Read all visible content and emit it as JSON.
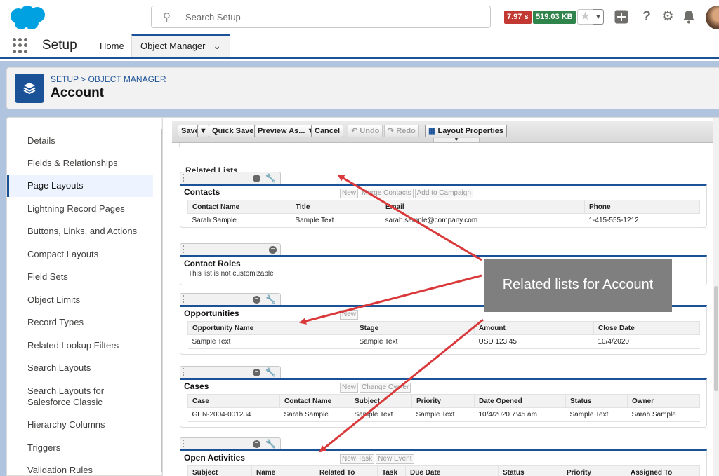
{
  "topbar": {
    "search_placeholder": "Search Setup",
    "badge_time": "7.97 s",
    "badge_size": "519.03 KB",
    "icons": [
      "salesforce-cloud-logo",
      "search-icon",
      "star-icon",
      "chevron-down-icon",
      "add-icon",
      "help-icon",
      "gear-icon",
      "bell-icon",
      "avatar"
    ]
  },
  "nav": {
    "app_name": "Setup",
    "tabs": [
      {
        "label": "Home",
        "active": false
      },
      {
        "label": "Object Manager",
        "active": true
      }
    ]
  },
  "header": {
    "breadcrumb": "SETUP > OBJECT MANAGER",
    "title": "Account"
  },
  "sidebar": {
    "items": [
      {
        "label": "Details",
        "active": false
      },
      {
        "label": "Fields & Relationships",
        "active": false
      },
      {
        "label": "Page Layouts",
        "active": true
      },
      {
        "label": "Lightning Record Pages",
        "active": false
      },
      {
        "label": "Buttons, Links, and Actions",
        "active": false
      },
      {
        "label": "Compact Layouts",
        "active": false
      },
      {
        "label": "Field Sets",
        "active": false
      },
      {
        "label": "Object Limits",
        "active": false
      },
      {
        "label": "Record Types",
        "active": false
      },
      {
        "label": "Related Lookup Filters",
        "active": false
      },
      {
        "label": "Search Layouts",
        "active": false
      },
      {
        "label": "Search Layouts for Salesforce Classic",
        "active": false
      },
      {
        "label": "Hierarchy Columns",
        "active": false
      },
      {
        "label": "Triggers",
        "active": false
      },
      {
        "label": "Validation Rules",
        "active": false
      }
    ]
  },
  "toolbar": {
    "save": "Save",
    "quick_save": "Quick Save",
    "preview_as": "Preview As...",
    "cancel": "Cancel",
    "undo": "Undo",
    "redo": "Redo",
    "layout_properties": "Layout Properties"
  },
  "related_lists": {
    "heading": "Related Lists",
    "contacts": {
      "name": "Contacts",
      "buttons": [
        "New",
        "Merge Contacts",
        "Add to Campaign"
      ],
      "columns": [
        "Contact Name",
        "Title",
        "Email",
        "Phone"
      ],
      "row": [
        "Sarah Sample",
        "Sample Text",
        "sarah.sample@company.com",
        "1-415-555-1212"
      ]
    },
    "contact_roles": {
      "name": "Contact Roles",
      "note": "This list is not customizable"
    },
    "opportunities": {
      "name": "Opportunities",
      "buttons": [
        "New"
      ],
      "columns": [
        "Opportunity Name",
        "Stage",
        "Amount",
        "Close Date"
      ],
      "row": [
        "Sample Text",
        "Sample Text",
        "USD 123.45",
        "10/4/2020"
      ]
    },
    "cases": {
      "name": "Cases",
      "buttons": [
        "New",
        "Change Owner"
      ],
      "columns": [
        "Case",
        "Contact Name",
        "Subject",
        "Priority",
        "Date Opened",
        "Status",
        "Owner"
      ],
      "row": [
        "GEN-2004-001234",
        "Sarah Sample",
        "Sample Text",
        "Sample Text",
        "10/4/2020 7:45 am",
        "Sample Text",
        "Sarah Sample"
      ]
    },
    "open_activities": {
      "name": "Open Activities",
      "buttons": [
        "New Task",
        "New Event"
      ],
      "columns": [
        "Subject",
        "Name",
        "Related To",
        "Task",
        "Due Date",
        "Status",
        "Priority",
        "Assigned To"
      ]
    }
  },
  "annotation": {
    "callout_text": "Related lists for Account",
    "arrow_color": "#d9393a",
    "callout_bg": "#7f7f7f"
  },
  "colors": {
    "brand_blue": "#1b5297",
    "salesforce_blue": "#00a1e0",
    "badge_red": "#c23934",
    "badge_green": "#2e844a"
  }
}
